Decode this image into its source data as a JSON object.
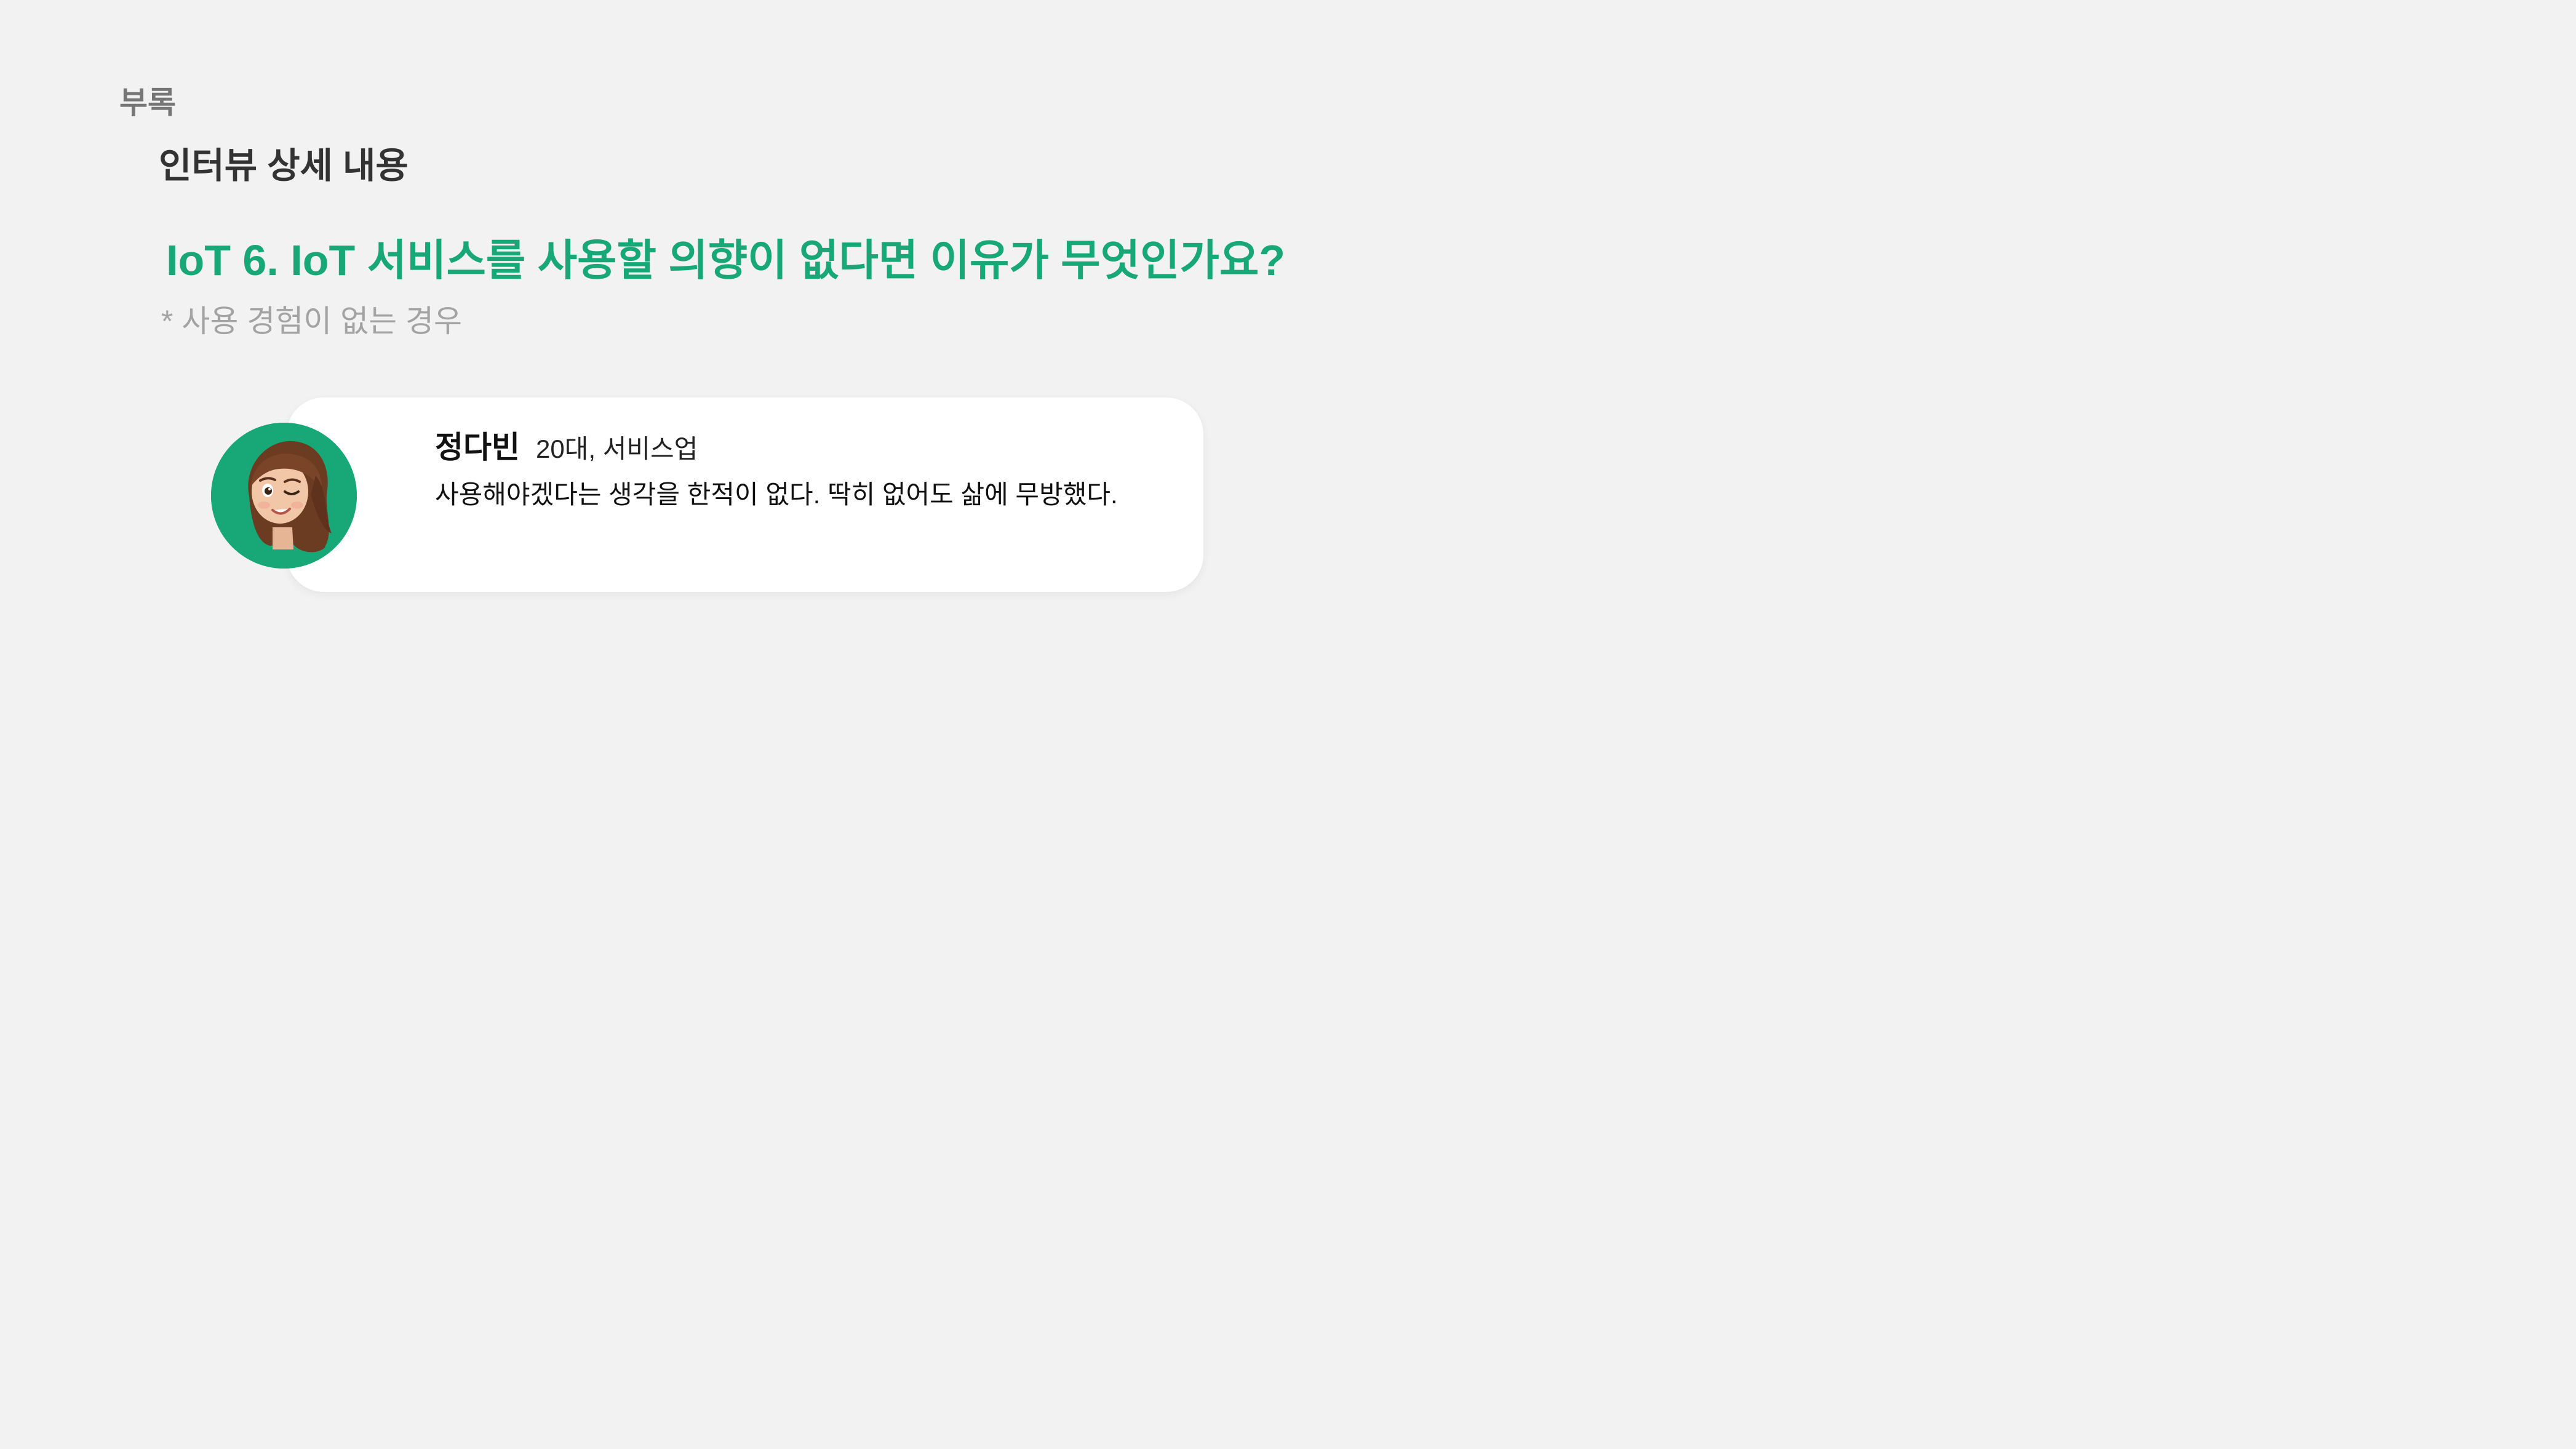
{
  "header": {
    "section_label": "부록",
    "title": "인터뷰 상세 내용"
  },
  "question": {
    "text": "IoT 6. IoT 서비스를 사용할 의향이 없다면 이유가 무엇인가요?",
    "note": "* 사용 경험이 없는 경우"
  },
  "responses": [
    {
      "avatar": "female-memoji-avatar",
      "name": "정다빈",
      "meta": "20대, 서비스업",
      "answer": "사용해야겠다는 생각을 한적이 없다. 딱히 없어도 삶에 무방했다."
    }
  ],
  "colors": {
    "background": "#f2f2f2",
    "accent": "#18a878",
    "card": "#ffffff"
  }
}
